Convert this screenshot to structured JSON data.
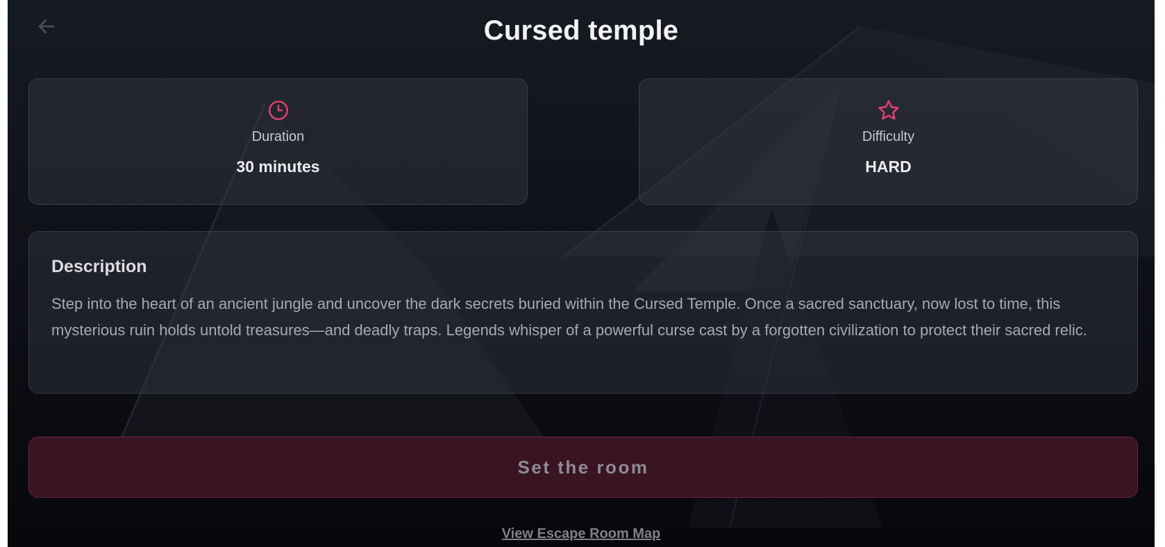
{
  "header": {
    "title": "Cursed temple",
    "back_icon": "arrow-left-icon"
  },
  "stats": {
    "duration": {
      "icon": "clock-icon",
      "label": "Duration",
      "value": "30 minutes"
    },
    "difficulty": {
      "icon": "star-icon",
      "label": "Difficulty",
      "value": "HARD"
    }
  },
  "description": {
    "title": "Description",
    "text": "Step into the heart of an ancient jungle and uncover the dark secrets buried within the Cursed Temple. Once a sacred sanctuary, now lost to time, this mysterious ruin holds untold treasures—and deadly traps. Legends whisper of a powerful curse cast by a forgotten civilization to protect their sacred relic."
  },
  "actions": {
    "primary_label": "Set the room",
    "map_link_label": "View Escape Room Map"
  },
  "colors": {
    "accent": "#e0406f",
    "background": "#0d0f13",
    "button_bg": "#3a1422"
  }
}
